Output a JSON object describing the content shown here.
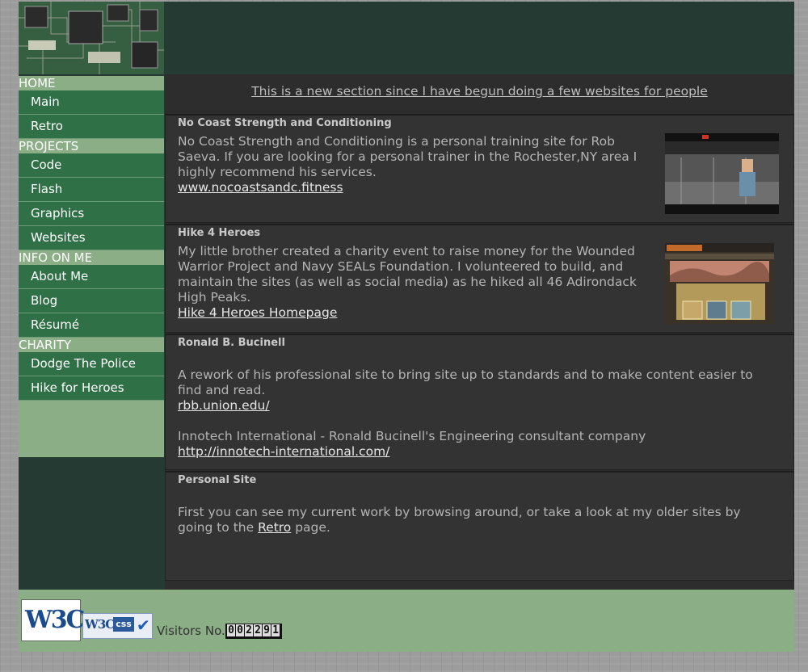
{
  "sidebar": {
    "groups": [
      {
        "heading": "HOME",
        "items": [
          "Main",
          "Retro"
        ]
      },
      {
        "heading": "PROJECTS",
        "items": [
          "Code",
          "Flash",
          "Graphics",
          "Websites"
        ]
      },
      {
        "heading": "INFO ON ME",
        "items": [
          "About Me",
          "Blog",
          "Résumé"
        ]
      },
      {
        "heading": "CHARITY",
        "items": [
          "Dodge The Police",
          "Hike for Heroes"
        ]
      }
    ]
  },
  "intro": "This is a new section since I have begun doing a few websites for people",
  "sections": [
    {
      "title": "No Coast Strength and Conditioning",
      "text": "No Coast Strength and Conditioning is a personal training site for Rob Saeva. If you are looking for a personal trainer in the Rochester,NY area I highly recommend his services.",
      "link": "www.nocoastsandc.fitness"
    },
    {
      "title": "Hike 4 Heroes",
      "text": "My little brother created a charity event to raise money for the Wounded Warrior Project and Navy SEALs Foundation. I volunteered to build, and maintain the sites (as well as social media) as he hiked all 46 Adirondack High Peaks.",
      "link": "Hike 4 Heroes Homepage"
    },
    {
      "title": "Ronald B. Bucinell",
      "text1": "A rework of his professional site to bring site up to standards and to make content easier to find and read.",
      "link1": "rbb.union.edu/",
      "text2": "Innotech International - Ronald Bucinell's Engineering consultant company",
      "link2": "http://innotech-international.com/"
    },
    {
      "title": "Personal Site",
      "text_before": "First you can see my current work by browsing around, or take a look at my older sites by going to the ",
      "link": "Retro",
      "text_after": " page."
    }
  ],
  "footer": {
    "w3c_label": "W3C",
    "w3c_css_label": "W3C",
    "css_label": "css",
    "visitors_label": "Visitors No.",
    "counter_digits": [
      "0",
      "0",
      "2",
      "2",
      "9",
      "1"
    ]
  },
  "colors": {
    "sidebar_heading": "#8bae86",
    "sidebar_item": "#2f7046",
    "content_bg": "#2d2d2d",
    "page_bg": "#243a33"
  }
}
